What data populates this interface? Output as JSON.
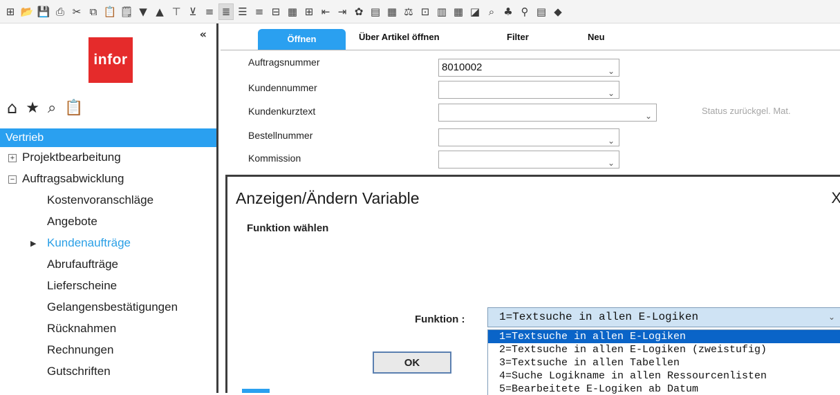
{
  "toolbar": {
    "icons": [
      "new-icon",
      "open-folder-icon",
      "save-icon",
      "print-icon",
      "cut-icon",
      "copy-icon",
      "paste-icon",
      "clipboard-icon",
      "arrow-down-icon",
      "arrow-up-icon",
      "filter-icon",
      "clear-filter-icon",
      "list-icon",
      "list-active-icon",
      "list-alt-icon",
      "list-lines-icon",
      "tree-icon",
      "table-icon",
      "tool-icon",
      "left-box-icon",
      "right-box-icon",
      "gear-icon",
      "document-icon",
      "calculator-icon",
      "scales-icon",
      "grid-icon",
      "chart-bar-icon",
      "table-edit-icon",
      "line-chart-icon",
      "search-doc-icon",
      "warning-icon",
      "sts-icon",
      "export-icon",
      "diamond-icon"
    ],
    "glyphs": [
      "⊞",
      "📂",
      "💾",
      "⎙",
      "✂",
      "⧉",
      "📋",
      "🗒",
      "▼",
      "▲",
      "⊤",
      "⊻",
      "≡",
      "≣",
      "☰",
      "≡",
      "⊟",
      "▦",
      "⊞",
      "⇤",
      "⇥",
      "✿",
      "▤",
      "▦",
      "⚖",
      "⊡",
      "▥",
      "▦",
      "◪",
      "⌕",
      "♣",
      "⚲",
      "▤",
      "◆"
    ],
    "active_index": 13
  },
  "sidebar": {
    "collapse": "«",
    "logo_text": "infor",
    "header": "Vertrieb",
    "items": [
      {
        "label": "Projektbearbeitung",
        "level": 0,
        "toggle": "+"
      },
      {
        "label": "Auftragsabwicklung",
        "level": 0,
        "toggle": "−"
      },
      {
        "label": "Kostenvoranschläge",
        "level": 1
      },
      {
        "label": "Angebote",
        "level": 1
      },
      {
        "label": "Kundenaufträge",
        "level": 1,
        "active": true
      },
      {
        "label": "Abrufaufträge",
        "level": 1
      },
      {
        "label": "Lieferscheine",
        "level": 1
      },
      {
        "label": "Gelangensbestätigungen",
        "level": 1
      },
      {
        "label": "Rücknahmen",
        "level": 1
      },
      {
        "label": "Rechnungen",
        "level": 1
      },
      {
        "label": "Gutschriften",
        "level": 1
      }
    ]
  },
  "tabs": [
    "Öffnen",
    "Über Artikel öffnen",
    "Filter",
    "Neu"
  ],
  "form": {
    "fields": [
      {
        "label": "Auftragsnummer",
        "value": "8010002"
      },
      {
        "label": "Kundennummer",
        "value": ""
      },
      {
        "label": "Kundenkurztext",
        "value": ""
      },
      {
        "label": "Bestellnummer",
        "value": ""
      },
      {
        "label": "Kommission",
        "value": ""
      }
    ],
    "status_text": "Status zurückgel. Mat."
  },
  "dialog": {
    "title": "Anzeigen/Ändern Variable",
    "close": "X",
    "heading": "Funktion wählen",
    "function_label": "Funktion :",
    "selected_value": "1=Textsuche in allen E-Logiken",
    "options": [
      "1=Textsuche in allen E-Logiken",
      "2=Textsuche in allen E-Logiken (zweistufig)",
      "3=Textsuche in allen Tabellen",
      "4=Suche Logikname in allen Ressourcenlisten",
      "5=Bearbeitete E-Logiken ab Datum"
    ],
    "ok_label": "OK"
  }
}
